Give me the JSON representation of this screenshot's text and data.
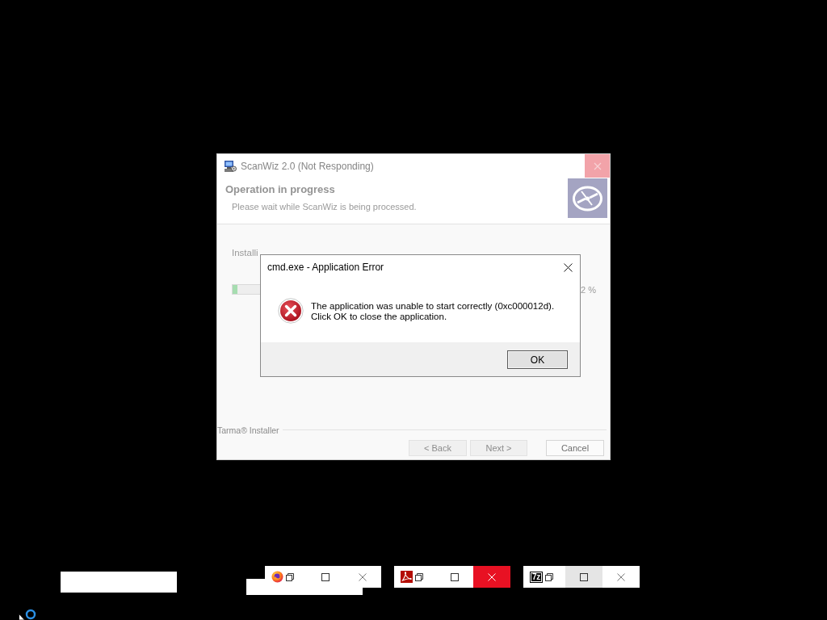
{
  "installer_window": {
    "title": "ScanWiz 2.0 (Not Responding)",
    "heading": "Operation in progress",
    "subheading": "Please wait while ScanWiz is being processed.",
    "progress": {
      "label": "Installi",
      "level": 0.015,
      "reading": "2 %"
    },
    "brand": "Tarma® Installer",
    "buttons": [
      {
        "label": "< Back",
        "disabled": true
      },
      {
        "label": "Next >",
        "disabled": true
      },
      {
        "label": "Cancel",
        "disabled": false
      }
    ]
  },
  "error_dialog": {
    "title": "cmd.exe - Application Error",
    "message_lines": [
      "The application was unable to start correctly (0xc000012d).",
      "Click OK to close the application."
    ],
    "button": "OK"
  },
  "minimized_windows": [
    {
      "kind": "blank"
    },
    {
      "kind": "blank"
    },
    {
      "kind": "caption",
      "logo": {
        "kind": "browser"
      },
      "buttons": [
        {
          "kind": "restore",
          "hovered": false
        },
        {
          "kind": "maximize",
          "hovered": false
        },
        {
          "kind": "close",
          "hovered": false
        }
      ]
    },
    {
      "kind": "caption",
      "logo": {
        "kind": "pdf"
      },
      "buttons": [
        {
          "kind": "restore",
          "hovered": false
        },
        {
          "kind": "maximize",
          "hovered": false
        },
        {
          "kind": "close",
          "hovered": true
        }
      ]
    },
    {
      "kind": "caption",
      "logo": {
        "kind": "text",
        "text": "7z"
      },
      "buttons": [
        {
          "kind": "restore",
          "hovered": false
        },
        {
          "kind": "maximize",
          "hovered": true
        },
        {
          "kind": "close",
          "hovered": false
        }
      ]
    }
  ],
  "pointer": {
    "busy": true
  }
}
